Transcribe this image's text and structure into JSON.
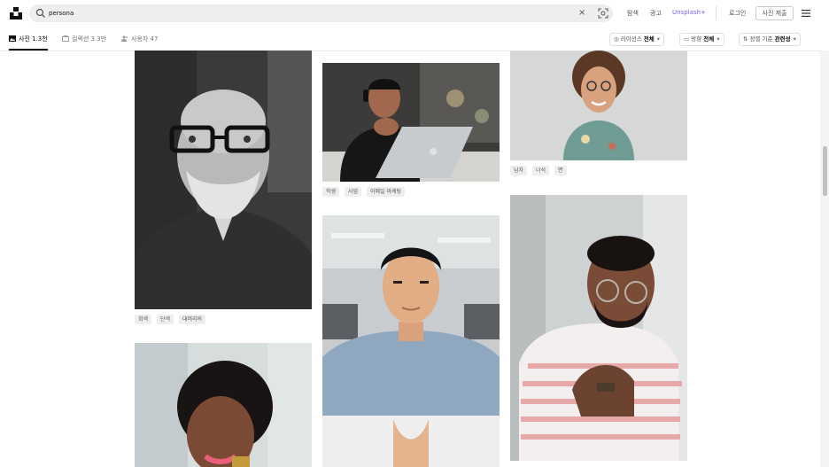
{
  "search": {
    "query": "persona"
  },
  "header": {
    "nav": [
      "탐색",
      "광고",
      "Unsplash+"
    ],
    "login": "로그인",
    "submit_photo": "사진 제출"
  },
  "tabs": [
    {
      "label": "사진 1.3천",
      "active": true
    },
    {
      "label": "컬렉션 3.3만",
      "active": false
    },
    {
      "label": "사용자 47",
      "active": false
    }
  ],
  "filters": [
    {
      "label": "라이선스",
      "value": "전체"
    },
    {
      "label": "방향",
      "value": "전체"
    },
    {
      "label": "정렬 기준",
      "value": "관련성"
    }
  ],
  "photos": [
    {
      "description": "bald man with glasses and grey beard",
      "tags": [
        "회색",
        "단색",
        "대머리의"
      ]
    },
    {
      "description": "woman with curly hair smiling",
      "tags": []
    },
    {
      "description": "man with headphones at laptop",
      "tags": [
        "학생",
        "사업",
        "이메일 마케팅"
      ]
    },
    {
      "description": "young man in denim shirt",
      "tags": []
    },
    {
      "description": "curly-haired man smiling",
      "tags": [
        "남자",
        "너석",
        "면"
      ]
    },
    {
      "description": "man with glasses in striped shirt",
      "tags": []
    }
  ],
  "colors": {
    "accent": "#7b5cf0",
    "tag_bg": "#eeeeee",
    "search_bg": "#eeeeee"
  }
}
